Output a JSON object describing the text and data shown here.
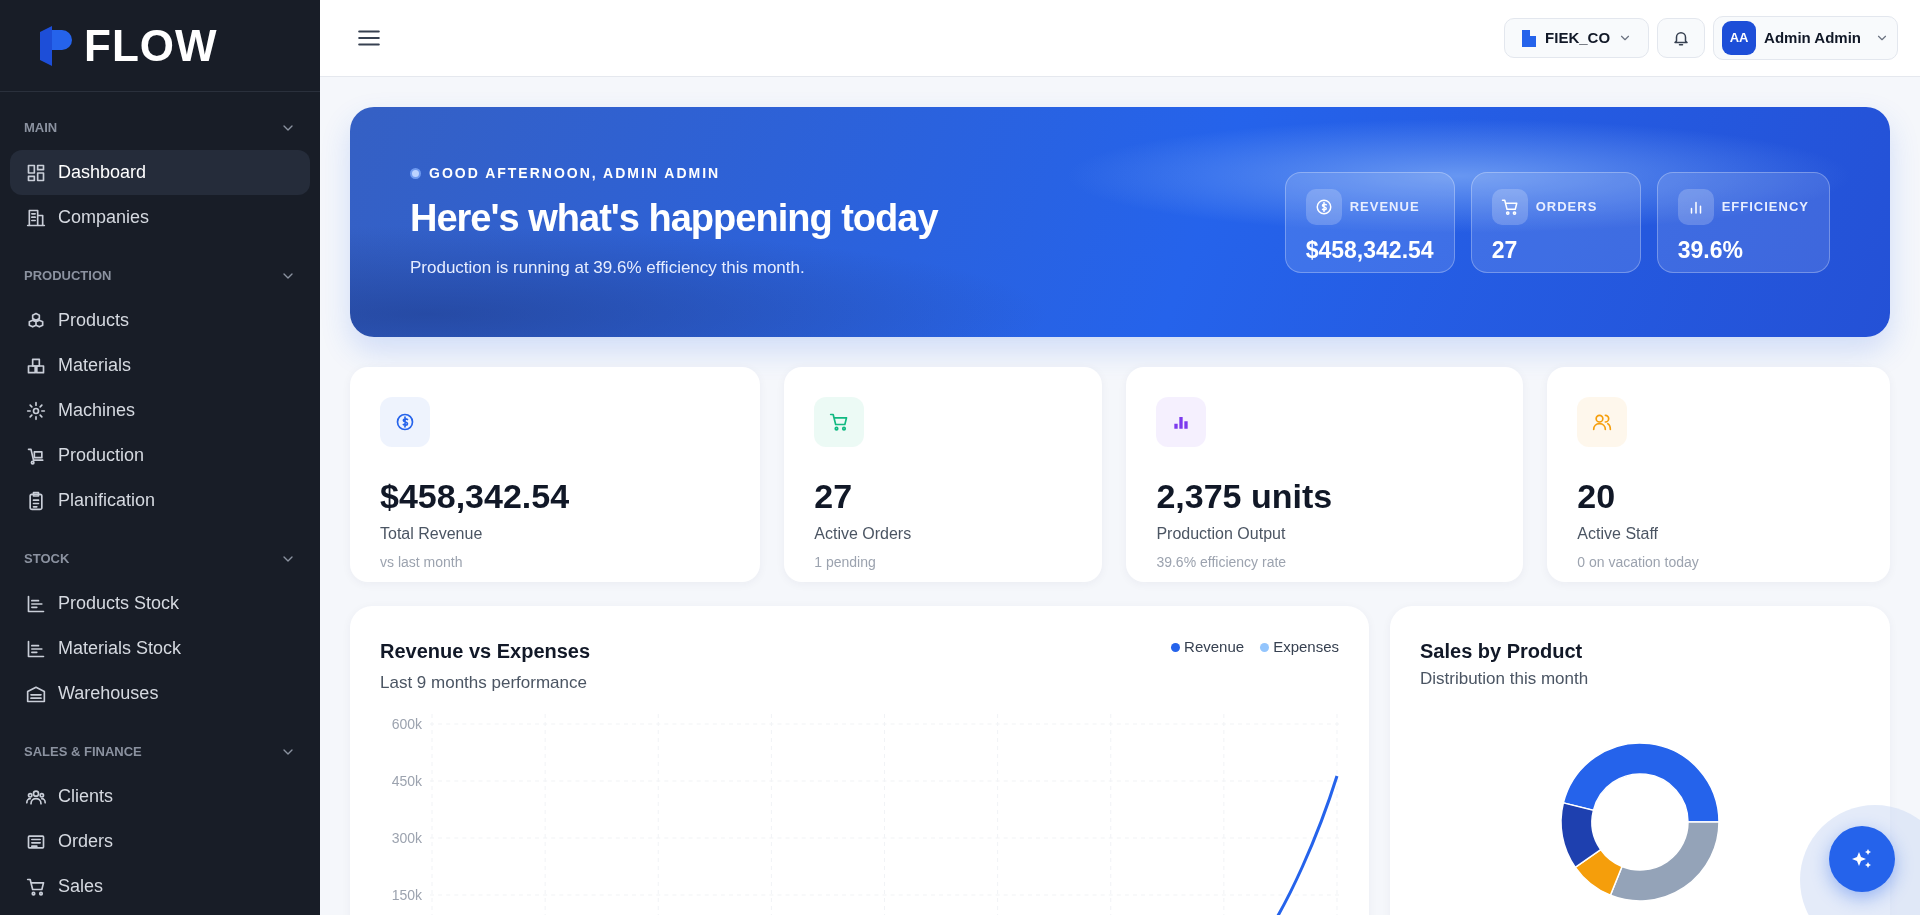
{
  "brand": {
    "name": "FLOW"
  },
  "sidebar": {
    "sections": [
      {
        "title": "MAIN",
        "expanded": true,
        "items": [
          {
            "label": "Dashboard",
            "selected": true
          },
          {
            "label": "Companies",
            "selected": false
          }
        ]
      },
      {
        "title": "PRODUCTION",
        "expanded": true,
        "items": [
          {
            "label": "Products",
            "selected": false
          },
          {
            "label": "Materials",
            "selected": false
          },
          {
            "label": "Machines",
            "selected": false
          },
          {
            "label": "Production",
            "selected": false
          },
          {
            "label": "Planification",
            "selected": false
          }
        ]
      },
      {
        "title": "STOCK",
        "expanded": true,
        "items": [
          {
            "label": "Products Stock",
            "selected": false
          },
          {
            "label": "Materials Stock",
            "selected": false
          },
          {
            "label": "Warehouses",
            "selected": false
          }
        ]
      },
      {
        "title": "SALES & FINANCE",
        "expanded": true,
        "items": [
          {
            "label": "Clients",
            "selected": false
          },
          {
            "label": "Orders",
            "selected": false
          },
          {
            "label": "Sales",
            "selected": false
          }
        ]
      }
    ]
  },
  "header": {
    "company": "FIEK_CO",
    "user": {
      "initials": "AA",
      "name": "Admin Admin"
    }
  },
  "hero": {
    "greeting": "GOOD AFTERNOON, ADMIN ADMIN",
    "title": "Here's what's happening today",
    "subtitle": "Production is running at 39.6% efficiency this month.",
    "metrics": [
      {
        "label": "REVENUE",
        "value": "$458,342.54"
      },
      {
        "label": "ORDERS",
        "value": "27"
      },
      {
        "label": "EFFICIENCY",
        "value": "39.6%"
      }
    ]
  },
  "stats": [
    {
      "value": "$458,342.54",
      "label": "Total Revenue",
      "note": "vs last month",
      "color": "#2563eb"
    },
    {
      "value": "27",
      "label": "Active Orders",
      "note": "1 pending",
      "color": "#10b981"
    },
    {
      "value": "2,375 units",
      "label": "Production Output",
      "note": "39.6% efficiency rate",
      "color": "#7c3aed"
    },
    {
      "value": "20",
      "label": "Active Staff",
      "note": "0 on vacation today",
      "color": "#f59e0b"
    }
  ],
  "revenue_chart": {
    "title": "Revenue vs Expenses",
    "subtitle": "Last 9 months performance",
    "legend": [
      {
        "label": "Revenue",
        "color": "#2563eb"
      },
      {
        "label": "Expenses",
        "color": "#93c5fd"
      }
    ],
    "y_tick_labels": [
      "600k",
      "450k",
      "300k",
      "150k"
    ]
  },
  "sales_chart": {
    "title": "Sales by Product",
    "subtitle": "Distribution this month"
  }
}
